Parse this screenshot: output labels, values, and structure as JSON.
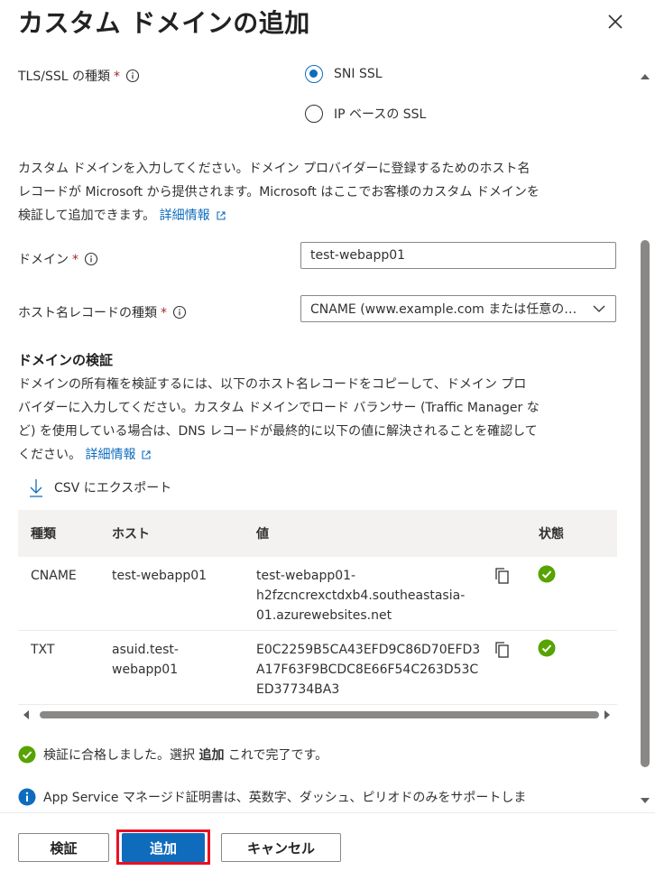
{
  "header": {
    "title": "カスタム ドメインの追加"
  },
  "tls": {
    "label": "TLS/SSL の種類",
    "required_mark": "*",
    "options": [
      {
        "label": "SNI SSL",
        "checked": true
      },
      {
        "label": "IP ベースの SSL",
        "checked": false
      }
    ]
  },
  "intro": {
    "line1": "カスタム ドメインを入力してください。ドメイン プロバイダーに登録するためのホスト名",
    "line2": "レコードが Microsoft から提供されます。Microsoft はここでお客様のカスタム ドメインを",
    "line3": "検証して追加できます。",
    "link": "詳細情報"
  },
  "domain": {
    "label": "ドメイン",
    "required_mark": "*",
    "value": "test-webapp01"
  },
  "record_type": {
    "label": "ホスト名レコードの種類",
    "required_mark": "*",
    "value": "CNAME (www.example.com または任意のサブドメイン)"
  },
  "verify": {
    "heading": "ドメインの検証",
    "line1": "ドメインの所有権を検証するには、以下のホスト名レコードをコピーして、ドメイン プロ",
    "line2": "バイダーに入力してください。カスタム ドメインでロード バランサー (Traffic Manager な",
    "line3": "ど) を使用している場合は、DNS レコードが最終的に以下の値に解決されることを確認して",
    "line4": "ください。",
    "link": "詳細情報",
    "export_label": "CSV にエクスポート"
  },
  "table": {
    "headers": {
      "type": "種類",
      "host": "ホスト",
      "value": "値",
      "status": "状態"
    },
    "rows": [
      {
        "type": "CNAME",
        "host": [
          "test-webapp01"
        ],
        "value": [
          "test-webapp01-",
          "h2fzcncrexctdxb4.southeastasia-",
          "01.azurewebsites.net"
        ]
      },
      {
        "type": "TXT",
        "host": [
          "asuid.test-",
          "webapp01"
        ],
        "value": [
          "E0C2259B5CA43EFD9C86D70EFD3",
          "A17F63F9BCDC8E66F54C263D53C",
          "ED37734BA3"
        ]
      }
    ]
  },
  "messages": {
    "success_prefix": "検証に合格しました。選択 ",
    "success_bold": "追加",
    "success_suffix": " これで完了です。",
    "info": "App Service マネージド証明書は、英数字、ダッシュ、ピリオドのみをサポートしま"
  },
  "footer": {
    "validate": "検証",
    "add": "追加",
    "cancel": "キャンセル"
  },
  "colors": {
    "accent": "#0f6cbd",
    "success": "#57a300",
    "required": "#a4262c",
    "highlight": "#e81123"
  }
}
